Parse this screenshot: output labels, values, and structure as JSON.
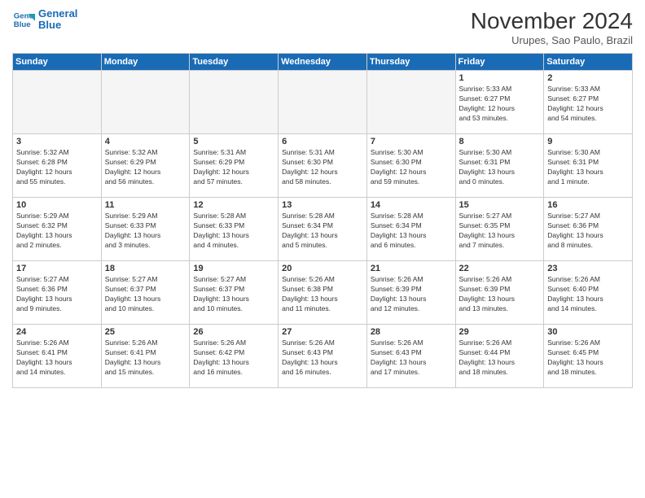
{
  "logo": {
    "line1": "General",
    "line2": "Blue"
  },
  "title": "November 2024",
  "location": "Urupes, Sao Paulo, Brazil",
  "weekdays": [
    "Sunday",
    "Monday",
    "Tuesday",
    "Wednesday",
    "Thursday",
    "Friday",
    "Saturday"
  ],
  "weeks": [
    [
      {
        "day": "",
        "info": ""
      },
      {
        "day": "",
        "info": ""
      },
      {
        "day": "",
        "info": ""
      },
      {
        "day": "",
        "info": ""
      },
      {
        "day": "",
        "info": ""
      },
      {
        "day": "1",
        "info": "Sunrise: 5:33 AM\nSunset: 6:27 PM\nDaylight: 12 hours\nand 53 minutes."
      },
      {
        "day": "2",
        "info": "Sunrise: 5:33 AM\nSunset: 6:27 PM\nDaylight: 12 hours\nand 54 minutes."
      }
    ],
    [
      {
        "day": "3",
        "info": "Sunrise: 5:32 AM\nSunset: 6:28 PM\nDaylight: 12 hours\nand 55 minutes."
      },
      {
        "day": "4",
        "info": "Sunrise: 5:32 AM\nSunset: 6:29 PM\nDaylight: 12 hours\nand 56 minutes."
      },
      {
        "day": "5",
        "info": "Sunrise: 5:31 AM\nSunset: 6:29 PM\nDaylight: 12 hours\nand 57 minutes."
      },
      {
        "day": "6",
        "info": "Sunrise: 5:31 AM\nSunset: 6:30 PM\nDaylight: 12 hours\nand 58 minutes."
      },
      {
        "day": "7",
        "info": "Sunrise: 5:30 AM\nSunset: 6:30 PM\nDaylight: 12 hours\nand 59 minutes."
      },
      {
        "day": "8",
        "info": "Sunrise: 5:30 AM\nSunset: 6:31 PM\nDaylight: 13 hours\nand 0 minutes."
      },
      {
        "day": "9",
        "info": "Sunrise: 5:30 AM\nSunset: 6:31 PM\nDaylight: 13 hours\nand 1 minute."
      }
    ],
    [
      {
        "day": "10",
        "info": "Sunrise: 5:29 AM\nSunset: 6:32 PM\nDaylight: 13 hours\nand 2 minutes."
      },
      {
        "day": "11",
        "info": "Sunrise: 5:29 AM\nSunset: 6:33 PM\nDaylight: 13 hours\nand 3 minutes."
      },
      {
        "day": "12",
        "info": "Sunrise: 5:28 AM\nSunset: 6:33 PM\nDaylight: 13 hours\nand 4 minutes."
      },
      {
        "day": "13",
        "info": "Sunrise: 5:28 AM\nSunset: 6:34 PM\nDaylight: 13 hours\nand 5 minutes."
      },
      {
        "day": "14",
        "info": "Sunrise: 5:28 AM\nSunset: 6:34 PM\nDaylight: 13 hours\nand 6 minutes."
      },
      {
        "day": "15",
        "info": "Sunrise: 5:27 AM\nSunset: 6:35 PM\nDaylight: 13 hours\nand 7 minutes."
      },
      {
        "day": "16",
        "info": "Sunrise: 5:27 AM\nSunset: 6:36 PM\nDaylight: 13 hours\nand 8 minutes."
      }
    ],
    [
      {
        "day": "17",
        "info": "Sunrise: 5:27 AM\nSunset: 6:36 PM\nDaylight: 13 hours\nand 9 minutes."
      },
      {
        "day": "18",
        "info": "Sunrise: 5:27 AM\nSunset: 6:37 PM\nDaylight: 13 hours\nand 10 minutes."
      },
      {
        "day": "19",
        "info": "Sunrise: 5:27 AM\nSunset: 6:37 PM\nDaylight: 13 hours\nand 10 minutes."
      },
      {
        "day": "20",
        "info": "Sunrise: 5:26 AM\nSunset: 6:38 PM\nDaylight: 13 hours\nand 11 minutes."
      },
      {
        "day": "21",
        "info": "Sunrise: 5:26 AM\nSunset: 6:39 PM\nDaylight: 13 hours\nand 12 minutes."
      },
      {
        "day": "22",
        "info": "Sunrise: 5:26 AM\nSunset: 6:39 PM\nDaylight: 13 hours\nand 13 minutes."
      },
      {
        "day": "23",
        "info": "Sunrise: 5:26 AM\nSunset: 6:40 PM\nDaylight: 13 hours\nand 14 minutes."
      }
    ],
    [
      {
        "day": "24",
        "info": "Sunrise: 5:26 AM\nSunset: 6:41 PM\nDaylight: 13 hours\nand 14 minutes."
      },
      {
        "day": "25",
        "info": "Sunrise: 5:26 AM\nSunset: 6:41 PM\nDaylight: 13 hours\nand 15 minutes."
      },
      {
        "day": "26",
        "info": "Sunrise: 5:26 AM\nSunset: 6:42 PM\nDaylight: 13 hours\nand 16 minutes."
      },
      {
        "day": "27",
        "info": "Sunrise: 5:26 AM\nSunset: 6:43 PM\nDaylight: 13 hours\nand 16 minutes."
      },
      {
        "day": "28",
        "info": "Sunrise: 5:26 AM\nSunset: 6:43 PM\nDaylight: 13 hours\nand 17 minutes."
      },
      {
        "day": "29",
        "info": "Sunrise: 5:26 AM\nSunset: 6:44 PM\nDaylight: 13 hours\nand 18 minutes."
      },
      {
        "day": "30",
        "info": "Sunrise: 5:26 AM\nSunset: 6:45 PM\nDaylight: 13 hours\nand 18 minutes."
      }
    ]
  ]
}
